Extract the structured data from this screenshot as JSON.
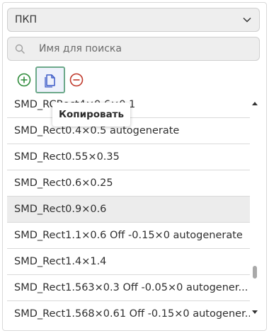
{
  "category_select": {
    "value": "ПКП"
  },
  "search": {
    "placeholder": "Имя для поиска"
  },
  "toolbar": {
    "tooltip": "Копировать"
  },
  "colors": {
    "add": "#2e8b3a",
    "copy": "#3d5bc7",
    "remove": "#c0392b",
    "selected_row": "#ececec"
  },
  "list": {
    "items": [
      {
        "label": "SMD_RCRect4×0.6×0.1"
      },
      {
        "label": "SMD_Rect0.4×0.5 autogenerate"
      },
      {
        "label": "SMD_Rect0.55×0.35"
      },
      {
        "label": "SMD_Rect0.6×0.25"
      },
      {
        "label": "SMD_Rect0.9×0.6",
        "selected": true
      },
      {
        "label": "SMD_Rect1.1×0.6 Off -0.15×0 autogenerate"
      },
      {
        "label": "SMD_Rect1.4×1.4"
      },
      {
        "label": "SMD_Rect1.563×0.3 Off -0.05×0 autogener..."
      },
      {
        "label": "SMD_Rect1.568×0.61 Off -0.15×0 autogener..."
      }
    ]
  }
}
